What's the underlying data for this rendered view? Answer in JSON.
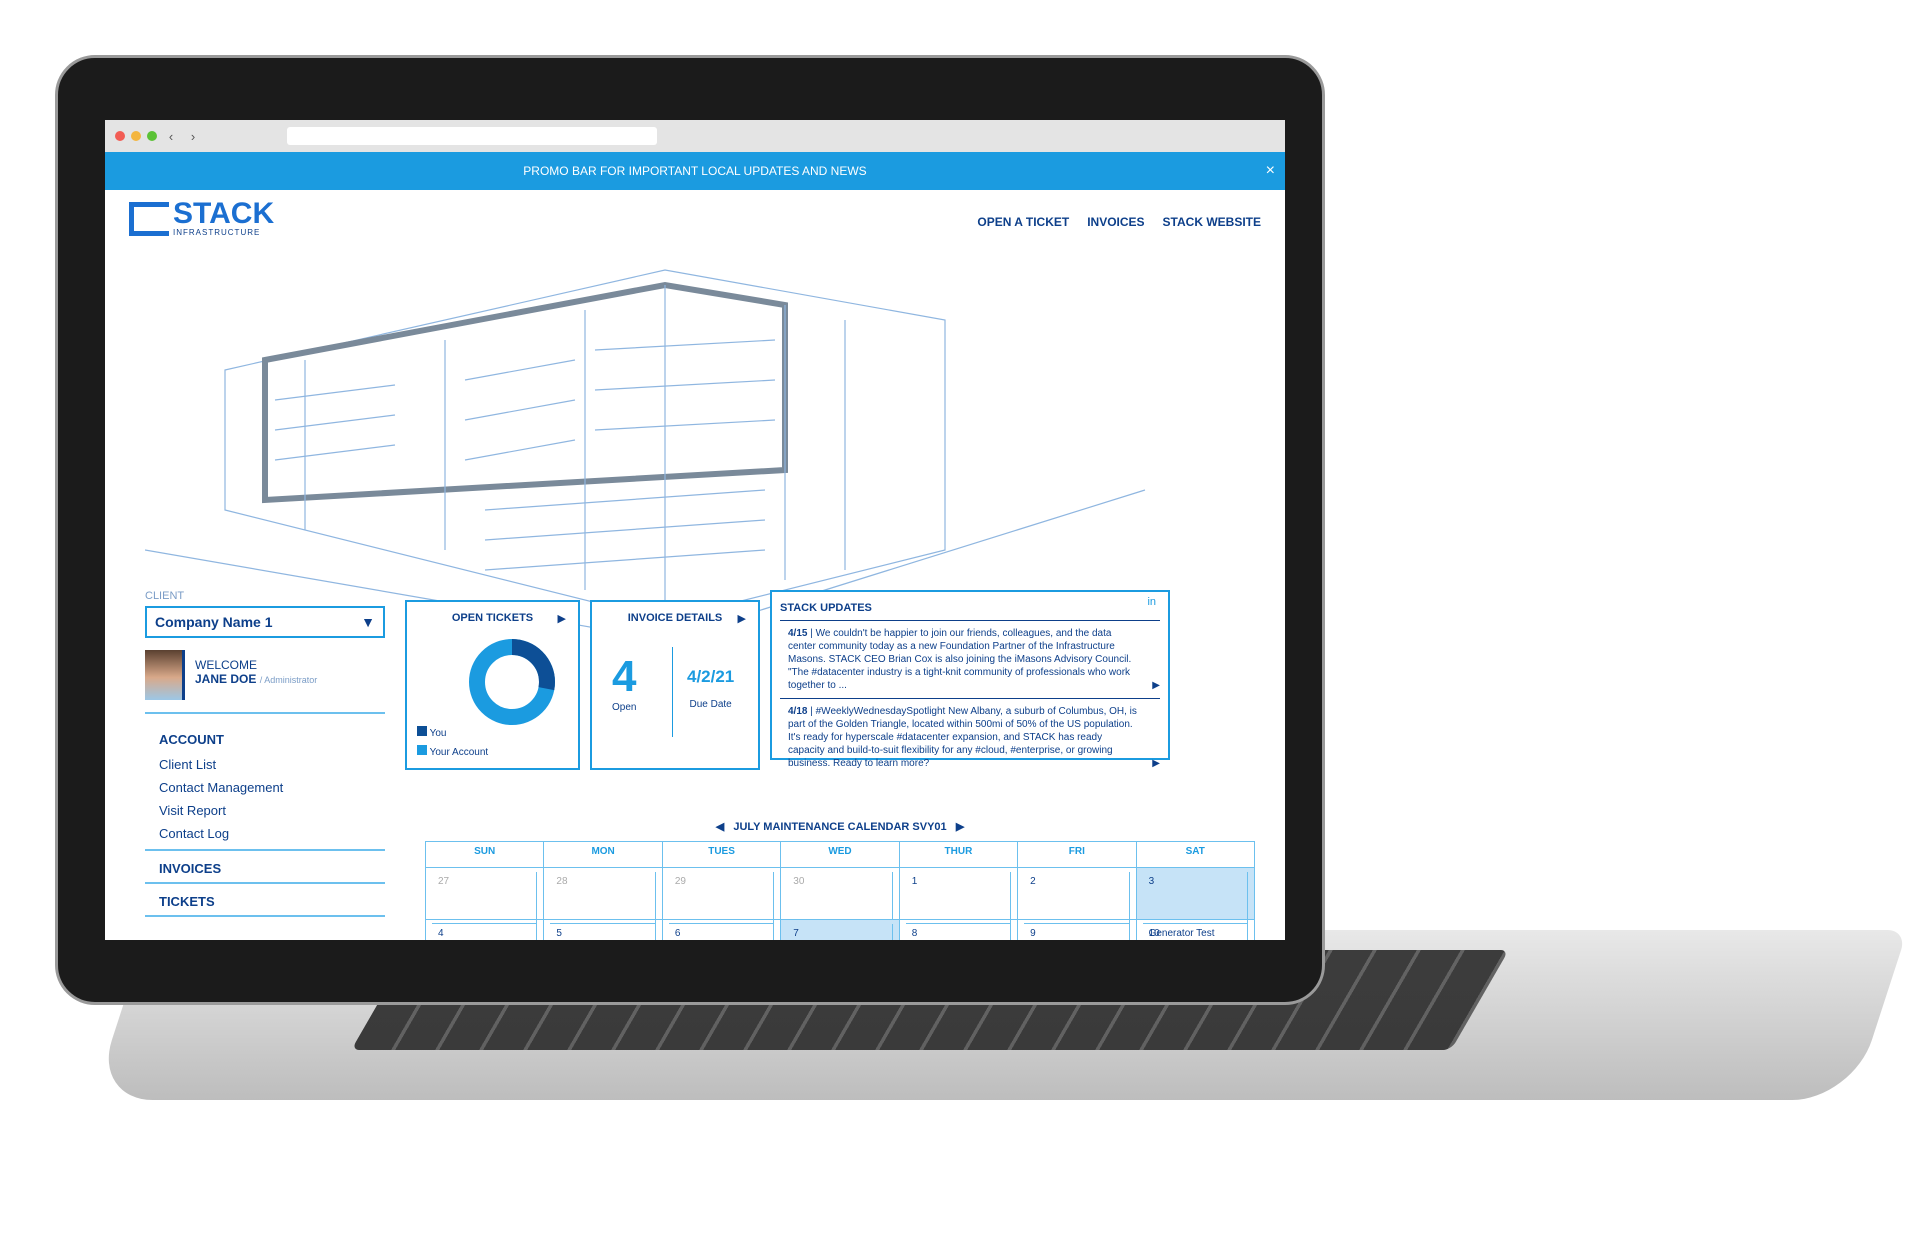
{
  "promo": {
    "text": "PROMO BAR FOR IMPORTANT LOCAL UPDATES AND NEWS",
    "close": "×"
  },
  "logo": {
    "name": "STACK",
    "sub": "INFRASTRUCTURE"
  },
  "nav": [
    "OPEN A TICKET",
    "INVOICES",
    "STACK WEBSITE"
  ],
  "sidebar": {
    "client_label": "CLIENT",
    "client_value": "Company Name 1",
    "welcome": "WELCOME",
    "user": "JANE DOE",
    "role": "/ Administrator",
    "account_heading": "ACCOUNT",
    "account_items": [
      "Client List",
      "Contact Management",
      "Visit Report",
      "Contact Log"
    ],
    "invoices": "INVOICES",
    "tickets": "TICKETS"
  },
  "open_tickets": {
    "title": "OPEN TICKETS",
    "legend": [
      "You",
      "Your Account"
    ],
    "you_fraction": 0.28,
    "colors": [
      "#0d4f96",
      "#1b9be0"
    ]
  },
  "invoice": {
    "title": "INVOICE DETAILS",
    "open_count": "4",
    "open_label": "Open",
    "due": "4/2/21",
    "due_label": "Due Date"
  },
  "updates": {
    "title": "STACK UPDATES",
    "icon": "linkedin-icon",
    "items": [
      {
        "date": "4/15",
        "text": "We couldn't be happier to join our friends, colleagues, and the data center community today as a new Foundation Partner of the Infrastructure Masons. STACK CEO Brian Cox is also joining the iMasons Advisory Council. \"The #datacenter industry is a tight-knit community of professionals who work together to ..."
      },
      {
        "date": "4/18",
        "text": "#WeeklyWednesdaySpotlight New Albany, a suburb of Columbus, OH, is part of the Golden Triangle, located within 500mi of 50% of the US population. It's ready for hyperscale #datacenter expansion, and STACK has ready capacity and build-to-suit flexibility for any #cloud, #enterprise, or growing business. Ready to learn more?"
      }
    ]
  },
  "calendar": {
    "title": "JULY MAINTENANCE CALENDAR SVY01",
    "days": [
      "SUN",
      "MON",
      "TUES",
      "WED",
      "THUR",
      "FRI",
      "SAT"
    ],
    "cells": [
      {
        "d": "27",
        "grey": true
      },
      {
        "d": "28",
        "grey": true
      },
      {
        "d": "29",
        "grey": true
      },
      {
        "d": "30",
        "grey": true
      },
      {
        "d": "1"
      },
      {
        "d": "2"
      },
      {
        "d": "3",
        "event": "Generator Test",
        "hl": true
      },
      {
        "d": "4"
      },
      {
        "d": "5"
      },
      {
        "d": "6"
      },
      {
        "d": "7",
        "hl": true
      },
      {
        "d": "8"
      },
      {
        "d": "9"
      },
      {
        "d": "10"
      }
    ]
  }
}
